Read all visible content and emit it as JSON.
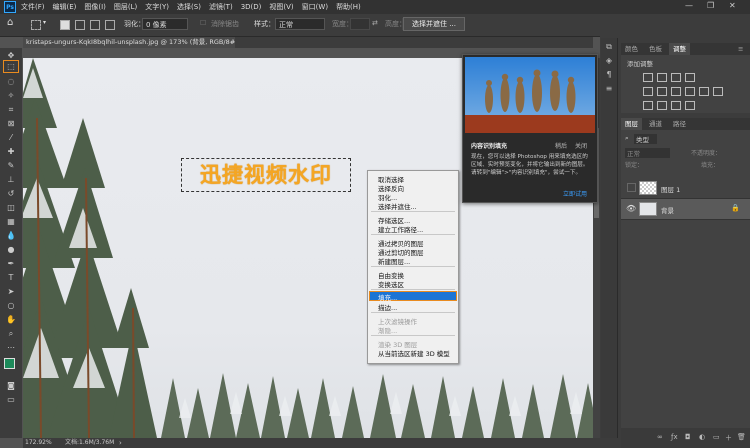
{
  "app": {
    "logo": "Ps",
    "window_controls": [
      "—",
      "❐",
      "✕"
    ]
  },
  "menu": [
    "文件(F)",
    "编辑(E)",
    "图像(I)",
    "图层(L)",
    "文字(Y)",
    "选择(S)",
    "滤镜(T)",
    "3D(D)",
    "视图(V)",
    "窗口(W)",
    "帮助(H)"
  ],
  "options": {
    "feather_label": "羽化：",
    "feather_value": "0 像素",
    "antialias_label": "消除锯齿",
    "style_label": "样式：",
    "style_value": "正常",
    "width_label": "宽度：",
    "height_label": "高度：",
    "select_mask_button": "选择并遮住 ..."
  },
  "document": {
    "tab_title": "kristaps-ungurs-KqkI8bqlhil-unsplash.jpg @ 173% (背景, RGB/8#) *",
    "tab_close": "×",
    "watermark_text": "迅捷视频水印"
  },
  "status": {
    "zoom": "172.92%",
    "doc_info": "文档:1.6M/3.76M"
  },
  "context_menu": {
    "items": [
      {
        "label": "取消选择",
        "enabled": true
      },
      {
        "label": "选择反向",
        "enabled": true
      },
      {
        "label": "羽化...",
        "enabled": true
      },
      {
        "label": "选择并遮住...",
        "enabled": true
      },
      {
        "label": "存储选区...",
        "enabled": true
      },
      {
        "label": "建立工作路径...",
        "enabled": true
      },
      {
        "label": "通过拷贝的图层",
        "enabled": true
      },
      {
        "label": "通过剪切的图层",
        "enabled": true
      },
      {
        "label": "新建图层...",
        "enabled": true
      },
      {
        "label": "自由变换",
        "enabled": true
      },
      {
        "label": "变换选区",
        "enabled": true
      },
      {
        "label": "填充...",
        "enabled": true,
        "highlighted": true
      },
      {
        "label": "描边...",
        "enabled": true
      },
      {
        "label": "上次滤镜操作",
        "enabled": false
      },
      {
        "label": "渐隐...",
        "enabled": false
      },
      {
        "label": "渲染 3D 图层",
        "enabled": false
      },
      {
        "label": "从当前选区新建 3D 模型",
        "enabled": true
      }
    ]
  },
  "tooltip": {
    "title": "内容识别填充",
    "learn_more": "稍后",
    "close": "关闭",
    "body": "现在，您可以选择 Photoshop 用来填充选区的区域、实时预览变化，并将它输出到新的图层。请转到\"编辑\">\"内容识别填充\"，尝试一下。",
    "try_link": "立即试用"
  },
  "panels": {
    "top_tabs": [
      "颜色",
      "色板",
      "调整"
    ],
    "active_top_tab": "调整",
    "adjustments_title": "添加调整",
    "layer_tabs": [
      "图层",
      "通道",
      "路径"
    ],
    "layer_kind_label": "类型",
    "blend_mode": "正常",
    "opacity_label": "不透明度：",
    "lock_label": "锁定：",
    "fill_label": "填充：",
    "layers": [
      {
        "name": "图层 1",
        "visible": false
      },
      {
        "name": "背景",
        "visible": true,
        "selected": true
      }
    ]
  },
  "colors": {
    "accent_orange": "#e98b1f",
    "highlight_blue": "#1c74d4",
    "watermark": "#f5a623",
    "link_blue": "#3ba0ff"
  }
}
